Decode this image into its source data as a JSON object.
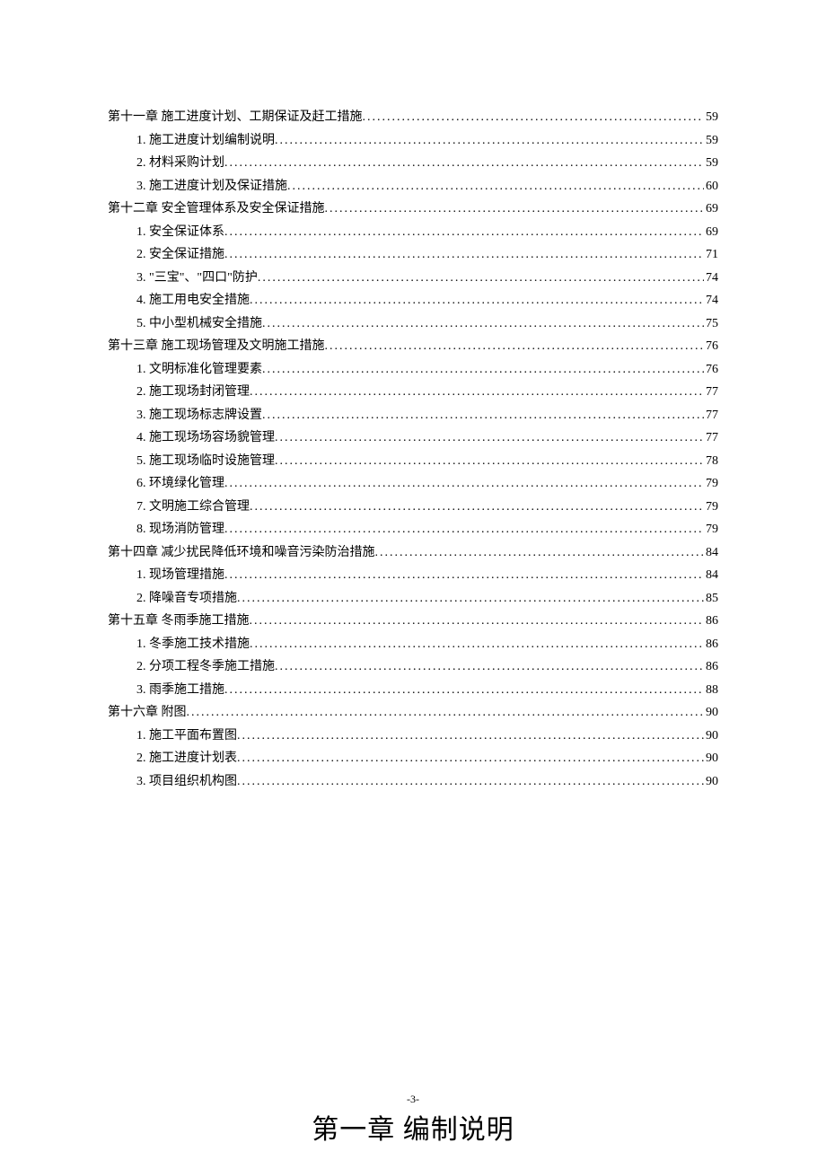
{
  "toc": [
    {
      "level": "chapter",
      "title": "第十一章 施工进度计划、工期保证及赶工措施",
      "page": "59"
    },
    {
      "level": "section",
      "title": "1. 施工进度计划编制说明 ",
      "page": "59"
    },
    {
      "level": "section",
      "title": "2. 材料采购计划  ",
      "page": "59"
    },
    {
      "level": "section",
      "title": "3. 施工进度计划及保证措施 ",
      "page": "60"
    },
    {
      "level": "chapter",
      "title": "第十二章 安全管理体系及安全保证措施",
      "page": "69"
    },
    {
      "level": "section",
      "title": "1. 安全保证体系 ",
      "page": "69"
    },
    {
      "level": "section",
      "title": "2. 安全保证措施 ",
      "page": "71"
    },
    {
      "level": "section",
      "title": "3. \"三宝\"、\"四口\"防护 ",
      "page": "74"
    },
    {
      "level": "section",
      "title": "4. 施工用电安全措施 ",
      "page": "74"
    },
    {
      "level": "section",
      "title": "5. 中小型机械安全措施 ",
      "page": "75"
    },
    {
      "level": "chapter",
      "title": "第十三章 施工现场管理及文明施工措施",
      "page": "76"
    },
    {
      "level": "section",
      "title": "1. 文明标准化管理要素 ",
      "page": "76"
    },
    {
      "level": "section",
      "title": "2. 施工现场封闭管理 ",
      "page": "77"
    },
    {
      "level": "section",
      "title": "3. 施工现场标志牌设置 ",
      "page": "77"
    },
    {
      "level": "section",
      "title": "4. 施工现场场容场貌管理 ",
      "page": "77"
    },
    {
      "level": "section",
      "title": "5. 施工现场临时设施管理 ",
      "page": "78"
    },
    {
      "level": "section",
      "title": "6. 环境绿化管理 ",
      "page": "79"
    },
    {
      "level": "section",
      "title": "7. 文明施工综合管理 ",
      "page": "79"
    },
    {
      "level": "section",
      "title": "8. 现场消防管理 ",
      "page": "79"
    },
    {
      "level": "chapter",
      "title": "第十四章 减少扰民降低环境和噪音污染防治措施",
      "page": "84"
    },
    {
      "level": "section",
      "title": "1. 现场管理措施 ",
      "page": "84"
    },
    {
      "level": "section",
      "title": "2. 降噪音专项措施 ",
      "page": "85"
    },
    {
      "level": "chapter",
      "title": "第十五章 冬雨季施工措施",
      "page": "86"
    },
    {
      "level": "section",
      "title": "1. 冬季施工技术措施 ",
      "page": "86"
    },
    {
      "level": "section",
      "title": "2. 分项工程冬季施工措施 ",
      "page": "86"
    },
    {
      "level": "section",
      "title": "3. 雨季施工措施 ",
      "page": "88"
    },
    {
      "level": "chapter",
      "title": "第十六章 附图",
      "page": "90"
    },
    {
      "level": "section",
      "title": "1. 施工平面布置图 ",
      "page": "90"
    },
    {
      "level": "section",
      "title": "2. 施工进度计划表 ",
      "page": "90"
    },
    {
      "level": "section",
      "title": "3. 项目组织机构图 ",
      "page": "90"
    }
  ],
  "heading": "第一章  编制说明",
  "page_number": "-3-"
}
